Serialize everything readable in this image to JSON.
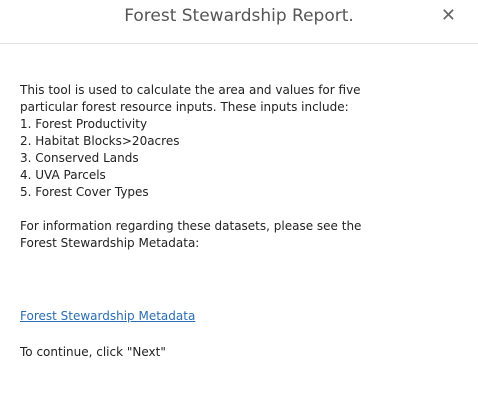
{
  "dialog": {
    "title": "Forest Stewardship Report.",
    "close_icon": "close-icon",
    "close_glyph": "✕"
  },
  "content": {
    "intro_line1": "This tool is used to calculate the area and values for five",
    "intro_line2": "particular forest resource inputs. These inputs include:",
    "inputs": [
      "1. Forest Productivity",
      "2. Habitat Blocks>20acres",
      "3. Conserved Lands",
      "4. UVA Parcels",
      "5. Forest Cover Types"
    ],
    "info_line1": "For information regarding these datasets, please see the",
    "info_line2": "Forest Stewardship Metadata:",
    "metadata_link": "Forest Stewardship Metadata",
    "continue_text": "To continue, click \"Next\""
  },
  "colors": {
    "link": "#2a6db3",
    "title": "#555555",
    "text": "#222222",
    "divider": "#e4e4e4"
  }
}
